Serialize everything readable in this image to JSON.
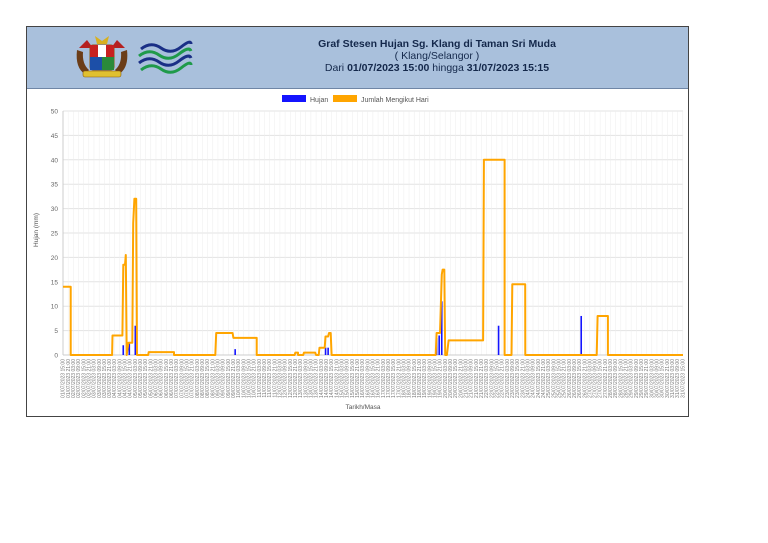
{
  "header": {
    "title": "Graf Stesen Hujan  Sg. Klang di Taman Sri Muda",
    "region": "( Klang/Selangor   )",
    "range_prefix": "Dari ",
    "range_start": "01/07/2023 15:00",
    "range_mid": " hingga ",
    "range_end": "31/07/2023 15:15",
    "crest_icon": "malaysia-coat-of-arms",
    "agency_icon": "water-wave-logo",
    "bg_color": "#a9c0dc"
  },
  "chart_data": {
    "type": "line",
    "xlabel": "Tarikh/Masa",
    "ylabel": "Hujan (mm)",
    "ylim": [
      0,
      50
    ],
    "yticks": [
      0,
      5,
      10,
      15,
      20,
      25,
      30,
      35,
      40,
      45,
      50
    ],
    "grid": true,
    "legend_position": "top-center",
    "x_range": [
      "01/07/2023 15:00",
      "31/07/2023 15:15"
    ],
    "tick_interval_hours": 6,
    "series": [
      {
        "name": "Hujan",
        "color": "#1414ff",
        "bars": [
          {
            "t": "04/07/2023 13:00",
            "v": 2
          },
          {
            "t": "04/07/2023 20:00",
            "v": 2.5
          },
          {
            "t": "05/07/2023 03:00",
            "v": 6
          },
          {
            "t": "09/07/2023 23:00",
            "v": 1.2
          },
          {
            "t": "14/07/2023 08:00",
            "v": 1.5
          },
          {
            "t": "14/07/2023 11:00",
            "v": 1.5
          },
          {
            "t": "19/07/2023 17:00",
            "v": 3.5
          },
          {
            "t": "19/07/2023 20:00",
            "v": 4
          },
          {
            "t": "19/07/2023 23:00",
            "v": 11
          },
          {
            "t": "22/07/2023 17:00",
            "v": 6
          },
          {
            "t": "26/07/2023 17:00",
            "v": 8
          }
        ]
      },
      {
        "name": "Jumlah Mengikut Hari",
        "color": "#ffa500",
        "points": [
          {
            "t": "01/07/2023 15:00",
            "v": 14
          },
          {
            "t": "01/07/2023 23:59",
            "v": 14
          },
          {
            "t": "02/07/2023 00:00",
            "v": 0
          },
          {
            "t": "03/07/2023 23:59",
            "v": 0
          },
          {
            "t": "04/07/2023 00:30",
            "v": 4
          },
          {
            "t": "04/07/2023 12:00",
            "v": 4
          },
          {
            "t": "04/07/2023 13:00",
            "v": 18.5
          },
          {
            "t": "04/07/2023 15:00",
            "v": 18.5
          },
          {
            "t": "04/07/2023 16:00",
            "v": 20.5
          },
          {
            "t": "04/07/2023 17:00",
            "v": 0
          },
          {
            "t": "04/07/2023 19:00",
            "v": 2.5
          },
          {
            "t": "04/07/2023 23:30",
            "v": 2.5
          },
          {
            "t": "05/07/2023 00:30",
            "v": 27
          },
          {
            "t": "05/07/2023 02:00",
            "v": 32
          },
          {
            "t": "05/07/2023 04:00",
            "v": 32
          },
          {
            "t": "05/07/2023 05:00",
            "v": 0
          },
          {
            "t": "05/07/2023 18:00",
            "v": 0
          },
          {
            "t": "05/07/2023 18:30",
            "v": 0.6
          },
          {
            "t": "06/07/2023 23:59",
            "v": 0.6
          },
          {
            "t": "07/07/2023 00:00",
            "v": 0
          },
          {
            "t": "08/07/2023 23:59",
            "v": 0
          },
          {
            "t": "09/07/2023 01:00",
            "v": 4.5
          },
          {
            "t": "09/07/2023 20:00",
            "v": 4.5
          },
          {
            "t": "09/07/2023 21:00",
            "v": 3.5
          },
          {
            "t": "10/07/2023 23:59",
            "v": 3.5
          },
          {
            "t": "11/07/2023 00:00",
            "v": 0
          },
          {
            "t": "12/07/2023 20:00",
            "v": 0
          },
          {
            "t": "12/07/2023 21:00",
            "v": 0.5
          },
          {
            "t": "12/07/2023 23:59",
            "v": 0.5
          },
          {
            "t": "13/07/2023 00:00",
            "v": 0
          },
          {
            "t": "13/07/2023 06:00",
            "v": 0
          },
          {
            "t": "13/07/2023 07:00",
            "v": 0.5
          },
          {
            "t": "13/07/2023 20:00",
            "v": 0.5
          },
          {
            "t": "13/07/2023 21:00",
            "v": 0
          },
          {
            "t": "14/07/2023 00:00",
            "v": 0
          },
          {
            "t": "14/07/2023 01:00",
            "v": 1.5
          },
          {
            "t": "14/07/2023 07:00",
            "v": 1.5
          },
          {
            "t": "14/07/2023 08:00",
            "v": 3.8
          },
          {
            "t": "14/07/2023 11:00",
            "v": 3.8
          },
          {
            "t": "14/07/2023 12:00",
            "v": 4.5
          },
          {
            "t": "14/07/2023 14:00",
            "v": 4.5
          },
          {
            "t": "14/07/2023 15:00",
            "v": 0
          },
          {
            "t": "19/07/2023 16:00",
            "v": 0
          },
          {
            "t": "19/07/2023 17:00",
            "v": 4.5
          },
          {
            "t": "19/07/2023 21:00",
            "v": 4.5
          },
          {
            "t": "19/07/2023 23:00",
            "v": 16.5
          },
          {
            "t": "20/07/2023 00:00",
            "v": 17.5
          },
          {
            "t": "20/07/2023 02:00",
            "v": 17.5
          },
          {
            "t": "20/07/2023 03:00",
            "v": 0
          },
          {
            "t": "20/07/2023 05:00",
            "v": 0
          },
          {
            "t": "20/07/2023 07:00",
            "v": 3
          },
          {
            "t": "21/07/2023 23:00",
            "v": 3
          },
          {
            "t": "22/07/2023 00:00",
            "v": 40
          },
          {
            "t": "22/07/2023 23:59",
            "v": 40
          },
          {
            "t": "23/07/2023 00:00",
            "v": 0
          },
          {
            "t": "23/07/2023 08:00",
            "v": 0
          },
          {
            "t": "23/07/2023 09:00",
            "v": 14.5
          },
          {
            "t": "23/07/2023 23:59",
            "v": 14.5
          },
          {
            "t": "24/07/2023 00:00",
            "v": 0
          },
          {
            "t": "27/07/2023 11:00",
            "v": 0
          },
          {
            "t": "27/07/2023 12:00",
            "v": 8
          },
          {
            "t": "27/07/2023 23:59",
            "v": 8
          },
          {
            "t": "28/07/2023 00:00",
            "v": 0
          },
          {
            "t": "31/07/2023 15:15",
            "v": 0
          }
        ]
      }
    ]
  }
}
